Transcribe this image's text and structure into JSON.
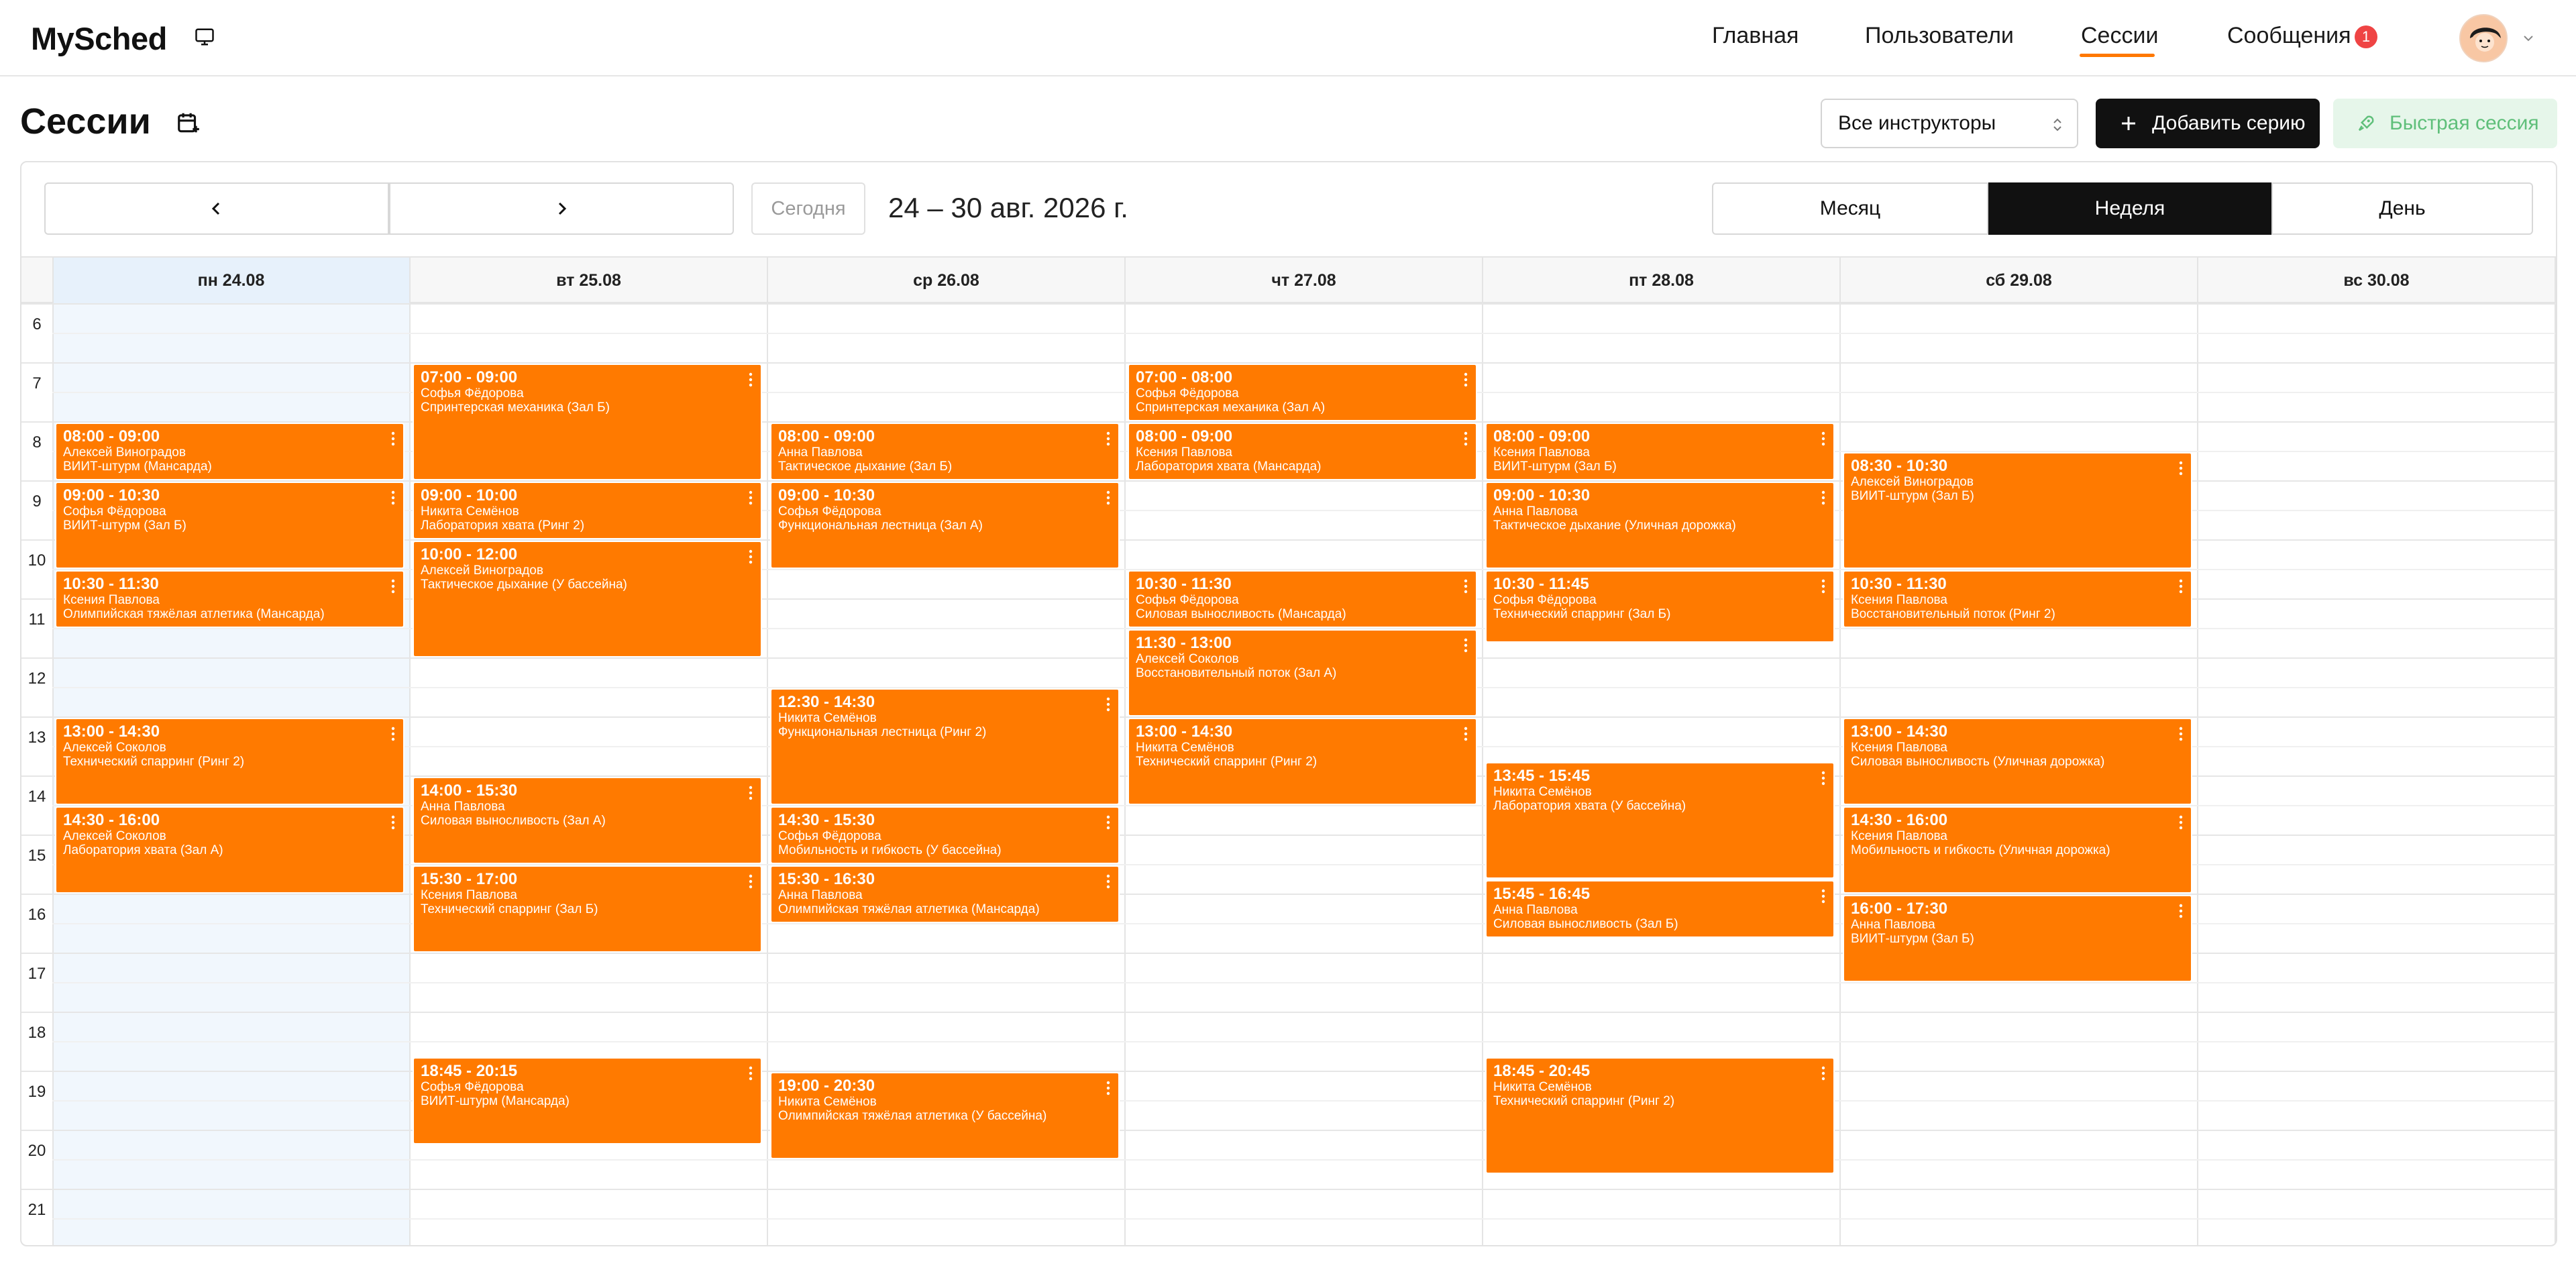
{
  "app": {
    "name": "MySched"
  },
  "nav": {
    "items": [
      {
        "label": "Главная",
        "active": false
      },
      {
        "label": "Пользователи",
        "active": false
      },
      {
        "label": "Сессии",
        "active": true
      },
      {
        "label": "Сообщения",
        "active": false,
        "badge": "1"
      }
    ]
  },
  "page": {
    "title": "Сессии",
    "instructor_filter": "Все инструкторы",
    "add_series_label": "Добавить серию",
    "quick_session_label": "Быстрая сессия"
  },
  "calendar": {
    "today_label": "Сегодня",
    "range_title": "24 – 30 авг. 2026 г.",
    "views": [
      {
        "label": "Месяц",
        "active": false
      },
      {
        "label": "Неделя",
        "active": true
      },
      {
        "label": "День",
        "active": false
      }
    ],
    "days": [
      "пн 24.08",
      "вт 25.08",
      "ср 26.08",
      "чт 27.08",
      "пт 28.08",
      "сб 29.08",
      "вс 30.08"
    ],
    "hours": [
      "6",
      "7",
      "8",
      "9",
      "10",
      "11",
      "12",
      "13",
      "14",
      "15",
      "16",
      "17",
      "18",
      "19",
      "20",
      "21"
    ],
    "accent": "#ff7a00",
    "events": [
      {
        "day": 0,
        "time": "08:00 - 09:00",
        "person": "Алексей Виноградов",
        "title": "ВИИТ-штурм (Мансарда)"
      },
      {
        "day": 0,
        "time": "09:00 - 10:30",
        "person": "Софья Фёдорова",
        "title": "ВИИТ-штурм (Зал Б)"
      },
      {
        "day": 0,
        "time": "10:30 - 11:30",
        "person": "Ксения Павлова",
        "title": "Олимпийская тяжёлая атлетика (Мансарда)"
      },
      {
        "day": 0,
        "time": "13:00 - 14:30",
        "person": "Алексей Соколов",
        "title": "Технический спарринг (Ринг 2)"
      },
      {
        "day": 0,
        "time": "14:30 - 16:00",
        "person": "Алексей Соколов",
        "title": "Лаборатория хвата (Зал А)"
      },
      {
        "day": 1,
        "time": "07:00 - 09:00",
        "person": "Софья Фёдорова",
        "title": "Спринтерская механика (Зал Б)"
      },
      {
        "day": 1,
        "time": "09:00 - 10:00",
        "person": "Никита Семёнов",
        "title": "Лаборатория хвата (Ринг 2)"
      },
      {
        "day": 1,
        "time": "10:00 - 12:00",
        "person": "Алексей Виноградов",
        "title": "Тактическое дыхание (У бассейна)"
      },
      {
        "day": 1,
        "time": "14:00 - 15:30",
        "person": "Анна Павлова",
        "title": "Силовая выносливость (Зал А)"
      },
      {
        "day": 1,
        "time": "15:30 - 17:00",
        "person": "Ксения Павлова",
        "title": "Технический спарринг (Зал Б)"
      },
      {
        "day": 1,
        "time": "18:45 - 20:15",
        "person": "Софья Фёдорова",
        "title": "ВИИТ-штурм (Мансарда)"
      },
      {
        "day": 2,
        "time": "08:00 - 09:00",
        "person": "Анна Павлова",
        "title": "Тактическое дыхание (Зал Б)"
      },
      {
        "day": 2,
        "time": "09:00 - 10:30",
        "person": "Софья Фёдорова",
        "title": "Функциональная лестница (Зал А)"
      },
      {
        "day": 2,
        "time": "12:30 - 14:30",
        "person": "Никита Семёнов",
        "title": "Функциональная лестница (Ринг 2)"
      },
      {
        "day": 2,
        "time": "14:30 - 15:30",
        "person": "Софья Фёдорова",
        "title": "Мобильность и гибкость (У бассейна)"
      },
      {
        "day": 2,
        "time": "15:30 - 16:30",
        "person": "Анна Павлова",
        "title": "Олимпийская тяжёлая атлетика (Мансарда)"
      },
      {
        "day": 2,
        "time": "19:00 - 20:30",
        "person": "Никита Семёнов",
        "title": "Олимпийская тяжёлая атлетика (У бассейна)"
      },
      {
        "day": 3,
        "time": "07:00 - 08:00",
        "person": "Софья Фёдорова",
        "title": "Спринтерская механика (Зал А)"
      },
      {
        "day": 3,
        "time": "08:00 - 09:00",
        "person": "Ксения Павлова",
        "title": "Лаборатория хвата (Мансарда)"
      },
      {
        "day": 3,
        "time": "10:30 - 11:30",
        "person": "Софья Фёдорова",
        "title": "Силовая выносливость (Мансарда)"
      },
      {
        "day": 3,
        "time": "11:30 - 13:00",
        "person": "Алексей Соколов",
        "title": "Восстановительный поток (Зал А)"
      },
      {
        "day": 3,
        "time": "13:00 - 14:30",
        "person": "Никита Семёнов",
        "title": "Технический спарринг (Ринг 2)"
      },
      {
        "day": 4,
        "time": "08:00 - 09:00",
        "person": "Ксения Павлова",
        "title": "ВИИТ-штурм (Зал Б)"
      },
      {
        "day": 4,
        "time": "09:00 - 10:30",
        "person": "Анна Павлова",
        "title": "Тактическое дыхание (Уличная дорожка)"
      },
      {
        "day": 4,
        "time": "10:30 - 11:45",
        "person": "Софья Фёдорова",
        "title": "Технический спарринг (Зал Б)"
      },
      {
        "day": 4,
        "time": "13:45 - 15:45",
        "person": "Никита Семёнов",
        "title": "Лаборатория хвата (У бассейна)"
      },
      {
        "day": 4,
        "time": "15:45 - 16:45",
        "person": "Анна Павлова",
        "title": "Силовая выносливость (Зал Б)"
      },
      {
        "day": 4,
        "time": "18:45 - 20:45",
        "person": "Никита Семёнов",
        "title": "Технический спарринг (Ринг 2)"
      },
      {
        "day": 5,
        "time": "08:30 - 10:30",
        "person": "Алексей Виноградов",
        "title": "ВИИТ-штурм (Зал Б)"
      },
      {
        "day": 5,
        "time": "10:30 - 11:30",
        "person": "Ксения Павлова",
        "title": "Восстановительный поток (Ринг 2)"
      },
      {
        "day": 5,
        "time": "13:00 - 14:30",
        "person": "Ксения Павлова",
        "title": "Силовая выносливость (Уличная дорожка)"
      },
      {
        "day": 5,
        "time": "14:30 - 16:00",
        "person": "Ксения Павлова",
        "title": "Мобильность и гибкость (Уличная дорожка)"
      },
      {
        "day": 5,
        "time": "16:00 - 17:30",
        "person": "Анна Павлова",
        "title": "ВИИТ-штурм (Зал Б)"
      }
    ]
  }
}
